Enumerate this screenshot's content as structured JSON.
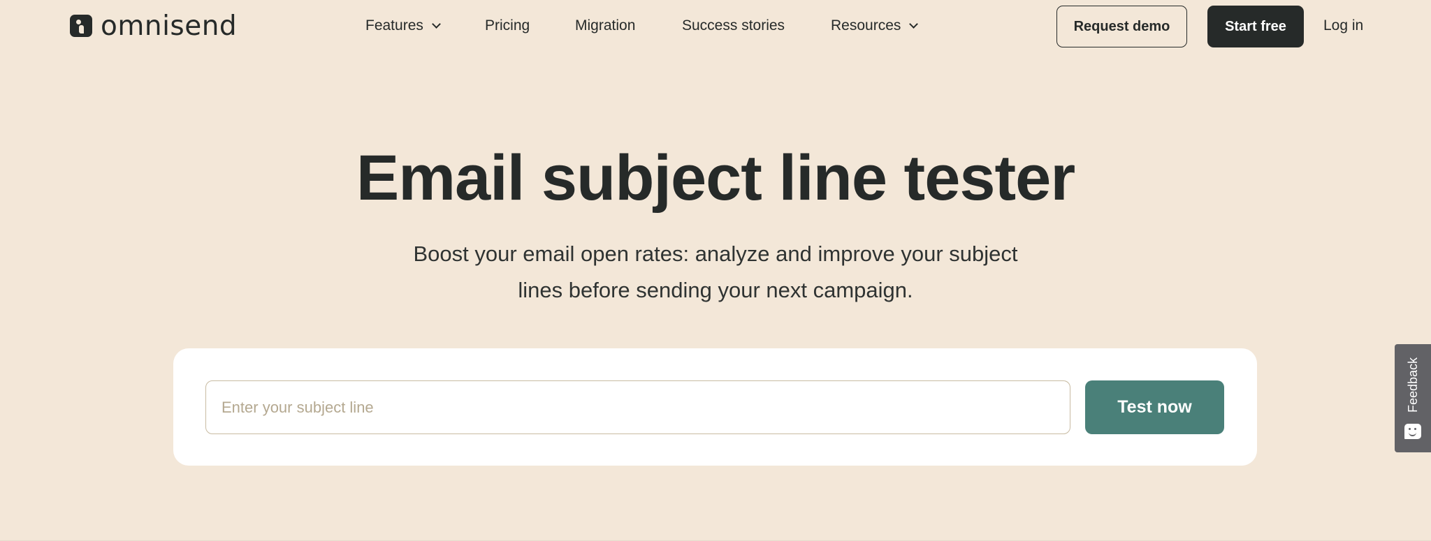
{
  "header": {
    "logo_text": "omnisend",
    "nav": [
      {
        "label": "Features",
        "has_dropdown": true
      },
      {
        "label": "Pricing",
        "has_dropdown": false
      },
      {
        "label": "Migration",
        "has_dropdown": false
      },
      {
        "label": "Success stories",
        "has_dropdown": false
      },
      {
        "label": "Resources",
        "has_dropdown": true
      }
    ],
    "request_demo_label": "Request demo",
    "start_free_label": "Start free",
    "login_label": "Log in"
  },
  "hero": {
    "title": "Email subject line tester",
    "subtitle": "Boost your email open rates: analyze and improve your subject lines before sending your next campaign."
  },
  "tester": {
    "input_value": "",
    "input_placeholder": "Enter your subject line",
    "button_label": "Test now"
  },
  "feedback": {
    "label": "Feedback",
    "icon": "chat-smile-icon"
  },
  "colors": {
    "background": "#f3e7d8",
    "text_dark": "#262a29",
    "accent_teal": "#4a8079",
    "feedback_gray": "#626266",
    "card_white": "#ffffff"
  }
}
